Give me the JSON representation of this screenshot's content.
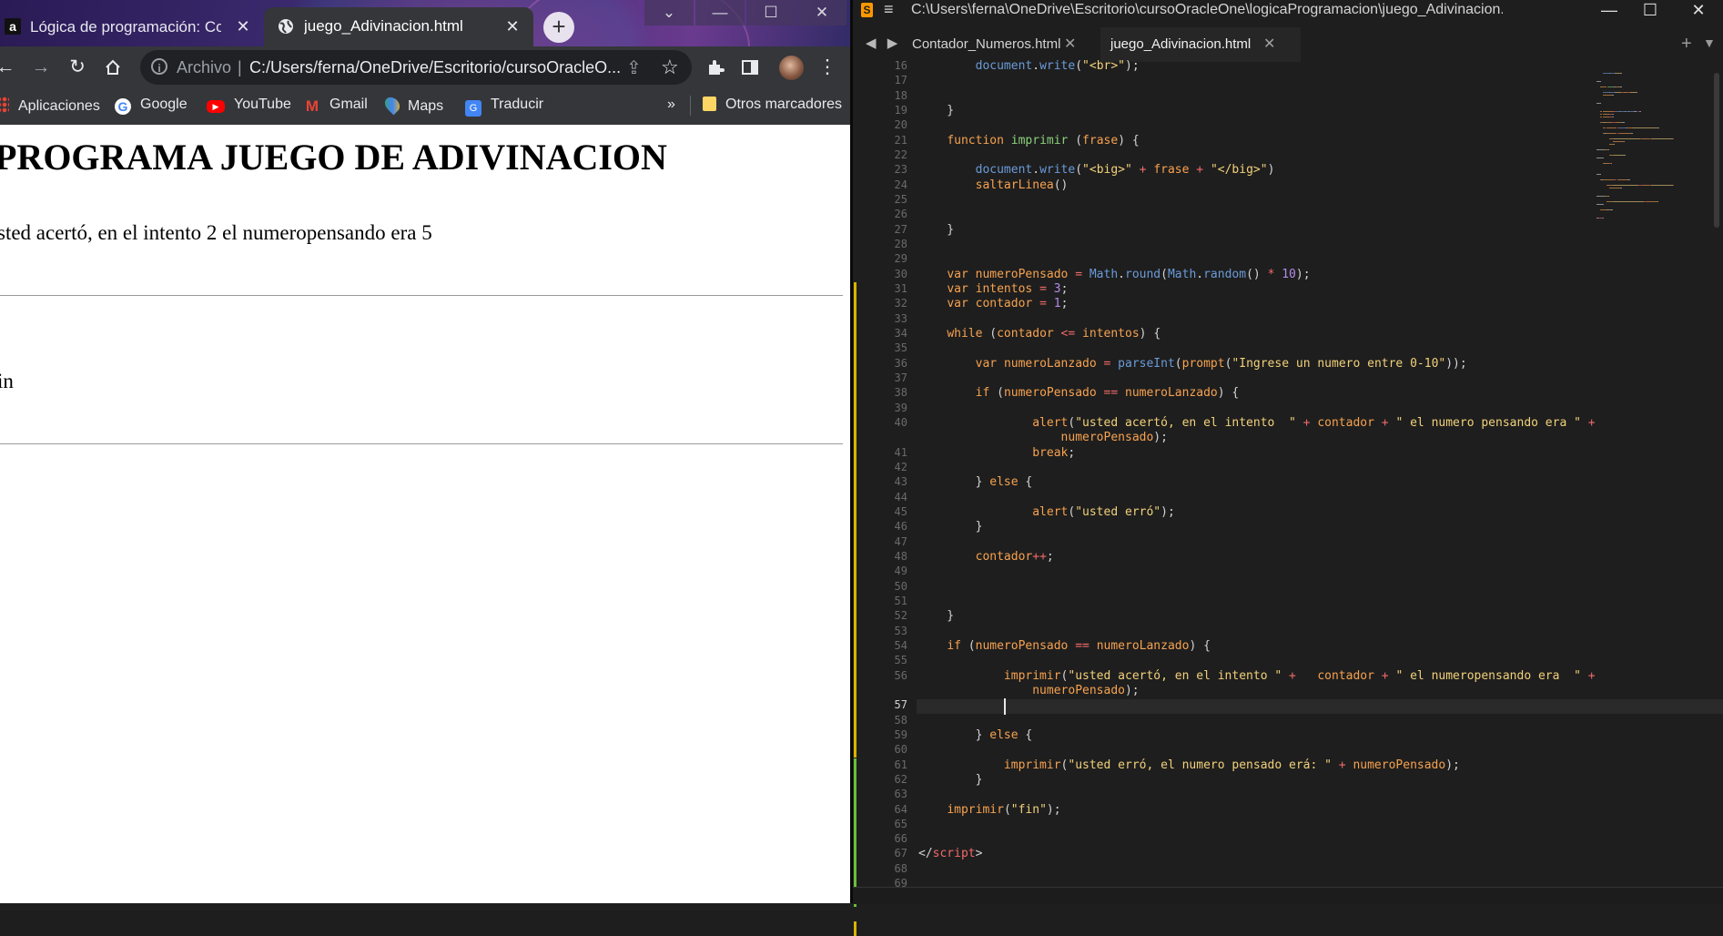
{
  "browser": {
    "tabs": [
      {
        "label": "Lógica de programación: Conce",
        "favicon": "a"
      },
      {
        "label": "juego_Adivinacion.html",
        "favicon": "globe-icon"
      }
    ],
    "new_tab": "+",
    "window_controls": [
      "⌄",
      "—",
      "☐",
      "✕"
    ],
    "address": {
      "scheme_label": "Archivo",
      "url": "C:/Users/ferna/OneDrive/Escritorio/cursoOracleO..."
    },
    "bookmarks": [
      {
        "label": "Aplicaciones",
        "icon": "apps-grid-icon"
      },
      {
        "label": "Google",
        "icon": "google-icon"
      },
      {
        "label": "YouTube",
        "icon": "youtube-icon"
      },
      {
        "label": "Gmail",
        "icon": "gmail-icon"
      },
      {
        "label": "Maps",
        "icon": "maps-icon"
      },
      {
        "label": "Traducir",
        "icon": "translate-icon"
      }
    ],
    "bookmarks_more": "»",
    "other_bookmarks": "Otros marcadores",
    "page": {
      "title": "PROGRAMA JUEGO DE ADIVINACION",
      "line1": "sted acertó, en el intento 2 el numeropensando era 5",
      "line2": "in"
    }
  },
  "editor": {
    "title_path": "C:\\Users\\ferna\\OneDrive\\Escritorio\\cursoOracleOne\\logicaProgramacion\\juego_Adivinacion.html - Sublime...",
    "window_controls": [
      "—",
      "☐",
      "✕"
    ],
    "nav_arrows": "◀ ▶",
    "tabs": [
      {
        "label": "Contador_Numeros.html",
        "close": "✕",
        "active": false
      },
      {
        "label": "juego_Adivinacion.html",
        "close": "✕",
        "active": true
      }
    ],
    "add_tab": "+",
    "tab_menu": "▼",
    "current_line": 57,
    "lines": [
      {
        "n": 16,
        "t": [
          [
            "        ",
            "plain"
          ],
          [
            "document",
            "obj"
          ],
          [
            ".",
            "plain"
          ],
          [
            "write",
            "obj"
          ],
          [
            "(",
            "plain"
          ],
          [
            "\"<br>\"",
            "str"
          ],
          [
            ");",
            "plain"
          ]
        ]
      },
      {
        "n": 17,
        "t": []
      },
      {
        "n": 18,
        "t": []
      },
      {
        "n": 19,
        "t": [
          [
            "    }",
            "plain"
          ]
        ]
      },
      {
        "n": 20,
        "t": []
      },
      {
        "n": 21,
        "t": [
          [
            "    ",
            "plain"
          ],
          [
            "function",
            "kw"
          ],
          [
            " ",
            "plain"
          ],
          [
            "imprimir",
            "fn"
          ],
          [
            " (",
            "plain"
          ],
          [
            "frase",
            "kw"
          ],
          [
            ") {",
            "plain"
          ]
        ]
      },
      {
        "n": 22,
        "t": []
      },
      {
        "n": 23,
        "t": [
          [
            "        ",
            "plain"
          ],
          [
            "document",
            "obj"
          ],
          [
            ".",
            "plain"
          ],
          [
            "write",
            "obj"
          ],
          [
            "(",
            "plain"
          ],
          [
            "\"<big>\"",
            "str"
          ],
          [
            " + ",
            "op"
          ],
          [
            "frase",
            "var"
          ],
          [
            " + ",
            "op"
          ],
          [
            "\"</big>\"",
            "str"
          ],
          [
            ")",
            "plain"
          ]
        ]
      },
      {
        "n": 24,
        "t": [
          [
            "        ",
            "plain"
          ],
          [
            "saltarLinea",
            "var"
          ],
          [
            "()",
            "plain"
          ]
        ]
      },
      {
        "n": 25,
        "t": []
      },
      {
        "n": 26,
        "t": []
      },
      {
        "n": 27,
        "t": [
          [
            "    }",
            "plain"
          ]
        ]
      },
      {
        "n": 28,
        "t": []
      },
      {
        "n": 29,
        "t": []
      },
      {
        "n": 30,
        "t": [
          [
            "    ",
            "plain"
          ],
          [
            "var",
            "kw"
          ],
          [
            " ",
            "plain"
          ],
          [
            "numeroPensado",
            "var"
          ],
          [
            " = ",
            "op"
          ],
          [
            "Math",
            "obj"
          ],
          [
            ".",
            "plain"
          ],
          [
            "round",
            "obj"
          ],
          [
            "(",
            "plain"
          ],
          [
            "Math",
            "obj"
          ],
          [
            ".",
            "plain"
          ],
          [
            "random",
            "obj"
          ],
          [
            "() ",
            "plain"
          ],
          [
            "*",
            "op"
          ],
          [
            " ",
            "plain"
          ],
          [
            "10",
            "num"
          ],
          [
            ");",
            "plain"
          ]
        ]
      },
      {
        "n": 31,
        "t": [
          [
            "    ",
            "plain"
          ],
          [
            "var",
            "kw"
          ],
          [
            " ",
            "plain"
          ],
          [
            "intentos",
            "var"
          ],
          [
            " = ",
            "op"
          ],
          [
            "3",
            "num"
          ],
          [
            ";",
            "plain"
          ]
        ]
      },
      {
        "n": 32,
        "t": [
          [
            "    ",
            "plain"
          ],
          [
            "var",
            "kw"
          ],
          [
            " ",
            "plain"
          ],
          [
            "contador",
            "var"
          ],
          [
            " = ",
            "op"
          ],
          [
            "1",
            "num"
          ],
          [
            ";",
            "plain"
          ]
        ]
      },
      {
        "n": 33,
        "t": []
      },
      {
        "n": 34,
        "t": [
          [
            "    ",
            "plain"
          ],
          [
            "while",
            "kw"
          ],
          [
            " (",
            "plain"
          ],
          [
            "contador",
            "var"
          ],
          [
            " <= ",
            "op"
          ],
          [
            "intentos",
            "var"
          ],
          [
            ") {",
            "plain"
          ]
        ]
      },
      {
        "n": 35,
        "t": []
      },
      {
        "n": 36,
        "t": [
          [
            "        ",
            "plain"
          ],
          [
            "var",
            "kw"
          ],
          [
            " ",
            "plain"
          ],
          [
            "numeroLanzado",
            "var"
          ],
          [
            " = ",
            "op"
          ],
          [
            "parseInt",
            "obj"
          ],
          [
            "(",
            "plain"
          ],
          [
            "prompt",
            "var"
          ],
          [
            "(",
            "plain"
          ],
          [
            "\"Ingrese un numero entre 0-10\"",
            "str"
          ],
          [
            "));",
            "plain"
          ]
        ]
      },
      {
        "n": 37,
        "t": []
      },
      {
        "n": 38,
        "t": [
          [
            "        ",
            "plain"
          ],
          [
            "if",
            "kw"
          ],
          [
            " (",
            "plain"
          ],
          [
            "numeroPensado",
            "var"
          ],
          [
            " == ",
            "op"
          ],
          [
            "numeroLanzado",
            "var"
          ],
          [
            ") {",
            "plain"
          ]
        ]
      },
      {
        "n": 39,
        "t": []
      },
      {
        "n": 40,
        "t": [
          [
            "                ",
            "plain"
          ],
          [
            "alert",
            "var"
          ],
          [
            "(",
            "plain"
          ],
          [
            "\"usted acertó, en el intento  \"",
            "str"
          ],
          [
            " + ",
            "op"
          ],
          [
            "contador",
            "var"
          ],
          [
            " + ",
            "op"
          ],
          [
            "\" el numero pensando era \"",
            "str"
          ],
          [
            " +",
            "op"
          ]
        ]
      },
      {
        "n": null,
        "t": [
          [
            "                    ",
            "plain"
          ],
          [
            "numeroPensado",
            "var"
          ],
          [
            ");",
            "plain"
          ]
        ]
      },
      {
        "n": 41,
        "t": [
          [
            "                ",
            "plain"
          ],
          [
            "break",
            "kw"
          ],
          [
            ";",
            "plain"
          ]
        ]
      },
      {
        "n": 42,
        "t": []
      },
      {
        "n": 43,
        "t": [
          [
            "        } ",
            "plain"
          ],
          [
            "else",
            "kw"
          ],
          [
            " {",
            "plain"
          ]
        ]
      },
      {
        "n": 44,
        "t": []
      },
      {
        "n": 45,
        "t": [
          [
            "                ",
            "plain"
          ],
          [
            "alert",
            "var"
          ],
          [
            "(",
            "plain"
          ],
          [
            "\"usted erró\"",
            "str"
          ],
          [
            ");",
            "plain"
          ]
        ]
      },
      {
        "n": 46,
        "t": [
          [
            "        }",
            "plain"
          ]
        ]
      },
      {
        "n": 47,
        "t": []
      },
      {
        "n": 48,
        "t": [
          [
            "        ",
            "plain"
          ],
          [
            "contador",
            "var"
          ],
          [
            "++",
            "op"
          ],
          [
            ";",
            "plain"
          ]
        ]
      },
      {
        "n": 49,
        "t": []
      },
      {
        "n": 50,
        "t": []
      },
      {
        "n": 51,
        "t": []
      },
      {
        "n": 52,
        "t": [
          [
            "    }",
            "plain"
          ]
        ]
      },
      {
        "n": 53,
        "t": []
      },
      {
        "n": 54,
        "t": [
          [
            "    ",
            "plain"
          ],
          [
            "if",
            "kw"
          ],
          [
            " (",
            "plain"
          ],
          [
            "numeroPensado",
            "var"
          ],
          [
            " == ",
            "op"
          ],
          [
            "numeroLanzado",
            "var"
          ],
          [
            ") {",
            "plain"
          ]
        ]
      },
      {
        "n": 55,
        "t": []
      },
      {
        "n": 56,
        "t": [
          [
            "            ",
            "plain"
          ],
          [
            "imprimir",
            "var"
          ],
          [
            "(",
            "plain"
          ],
          [
            "\"usted acertó, en el intento \"",
            "str"
          ],
          [
            " +   ",
            "op"
          ],
          [
            "contador",
            "var"
          ],
          [
            " + ",
            "op"
          ],
          [
            "\" el numeropensando era  \"",
            "str"
          ],
          [
            " +",
            "op"
          ]
        ]
      },
      {
        "n": null,
        "t": [
          [
            "                ",
            "plain"
          ],
          [
            "numeroPensado",
            "var"
          ],
          [
            ");",
            "plain"
          ]
        ]
      },
      {
        "n": 57,
        "t": []
      },
      {
        "n": 58,
        "t": []
      },
      {
        "n": 59,
        "t": [
          [
            "        } ",
            "plain"
          ],
          [
            "else",
            "kw"
          ],
          [
            " {",
            "plain"
          ]
        ]
      },
      {
        "n": 60,
        "t": []
      },
      {
        "n": 61,
        "t": [
          [
            "            ",
            "plain"
          ],
          [
            "imprimir",
            "var"
          ],
          [
            "(",
            "plain"
          ],
          [
            "\"usted erró, el numero pensado erá: \"",
            "str"
          ],
          [
            " + ",
            "op"
          ],
          [
            "numeroPensado",
            "var"
          ],
          [
            ");",
            "plain"
          ]
        ]
      },
      {
        "n": 62,
        "t": [
          [
            "        }",
            "plain"
          ]
        ]
      },
      {
        "n": 63,
        "t": []
      },
      {
        "n": 64,
        "t": [
          [
            "    ",
            "plain"
          ],
          [
            "imprimir",
            "var"
          ],
          [
            "(",
            "plain"
          ],
          [
            "\"fin\"",
            "str"
          ],
          [
            ");",
            "plain"
          ]
        ]
      },
      {
        "n": 65,
        "t": []
      },
      {
        "n": 66,
        "t": []
      },
      {
        "n": 67,
        "t": [
          [
            "</",
            "plain"
          ],
          [
            "script",
            "tag"
          ],
          [
            ">",
            "plain"
          ]
        ]
      },
      {
        "n": 68,
        "t": []
      },
      {
        "n": 69,
        "t": []
      }
    ],
    "colors": {
      "kw": "#f7a24f",
      "var": "#f7a24f",
      "fn": "#8ad17a",
      "obj": "#6b9bd8",
      "str": "#f2d17a",
      "num": "#b38ce8",
      "op": "#f26a6a",
      "plain": "#d4d4d4",
      "tag": "#f26a6a"
    }
  }
}
